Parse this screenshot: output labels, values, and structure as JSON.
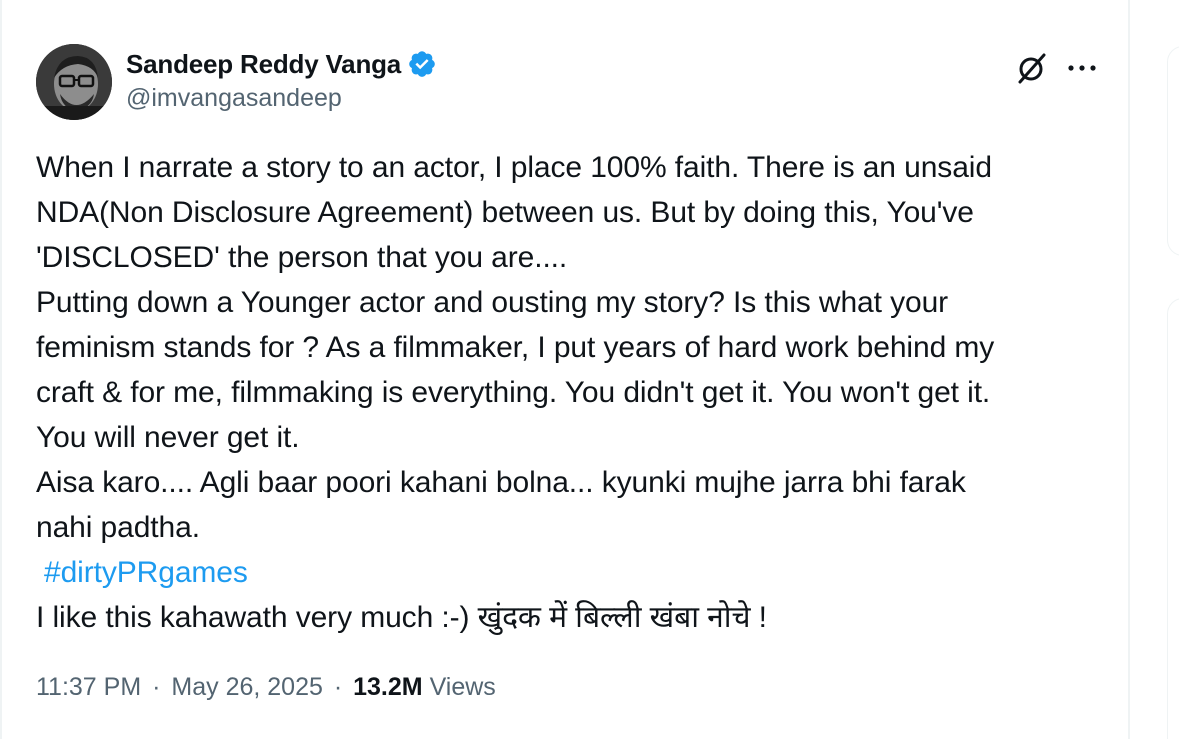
{
  "author": {
    "display_name": "Sandeep Reddy Vanga",
    "handle": "@imvangasandeep",
    "verified": true,
    "verified_color": "#1d9bf0"
  },
  "actions": {
    "grok_icon": "grok-slash-circle-icon",
    "more_icon": "more-horizontal-icon"
  },
  "tweet": {
    "lines": [
      "When I narrate a story to an actor, I place 100% faith. There is an unsaid",
      "NDA(Non Disclosure Agreement) between us. But by doing this, You've",
      "'DISCLOSED' the person that you are....",
      "Putting down a Younger actor and ousting my story?  Is this what your",
      "feminism stands for ? As a filmmaker, I put years of hard work behind my",
      "craft & for me, filmmaking is everything. You didn't get it. You won't get it.",
      "You will never get it.",
      "Aisa karo.... Agli baar poori kahani bolna... kyunki mujhe jarra bhi farak",
      "nahi padtha."
    ],
    "hashtag": "#dirtyPRgames",
    "last_line": "I like this kahawath very much :-) खुंदक में बिल्ली खंबा नोचे !"
  },
  "meta": {
    "time": "11:37 PM",
    "separator": "·",
    "date": "May 26, 2025",
    "views_count": "13.2M",
    "views_label": "Views"
  },
  "colors": {
    "text_primary": "#0f1419",
    "text_secondary": "#536471",
    "link": "#1d9bf0",
    "border": "#eff3f4"
  }
}
